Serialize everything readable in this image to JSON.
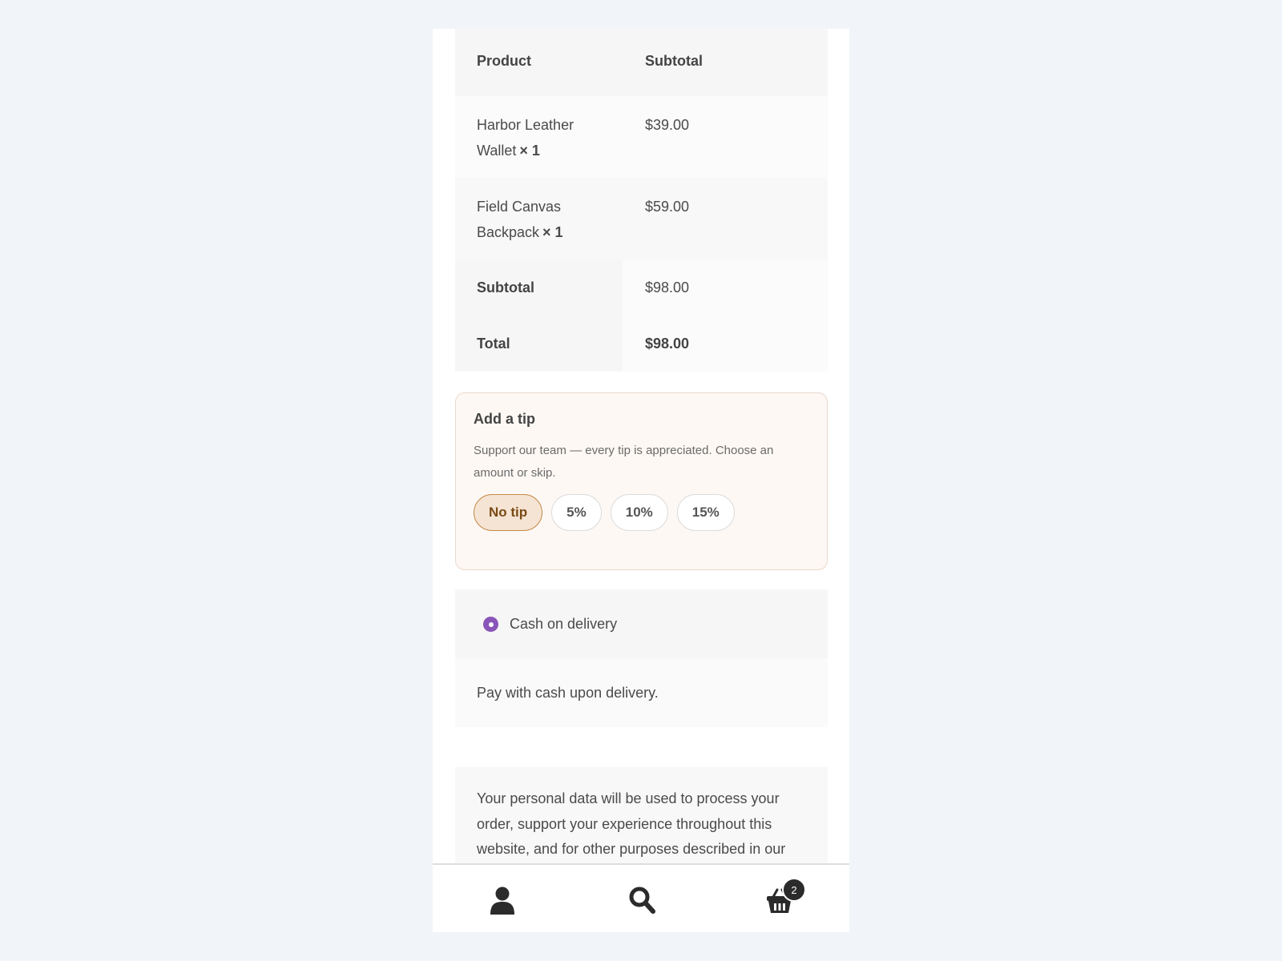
{
  "order": {
    "header": {
      "product": "Product",
      "subtotal": "Subtotal"
    },
    "items": [
      {
        "name": "Harbor Leather Wallet",
        "qty": "× 1",
        "price": "$39.00"
      },
      {
        "name": "Field Canvas Backpack",
        "qty": "× 1",
        "price": "$59.00"
      }
    ],
    "subtotal_label": "Subtotal",
    "subtotal_value": "$98.00",
    "total_label": "Total",
    "total_value": "$98.00"
  },
  "tip": {
    "title": "Add a tip",
    "description": "Support our team — every tip is appreciated. Choose an amount or skip.",
    "options": [
      "No tip",
      "5%",
      "10%",
      "15%"
    ],
    "selected": "No tip"
  },
  "payment": {
    "method_label": "Cash on delivery",
    "method_description": "Pay with cash upon delivery."
  },
  "privacy": {
    "text": "Your personal data will be used to process your order, support your experience throughout this website, and for other purposes described in our"
  },
  "bottom_nav": {
    "cart_count": "2",
    "icons": [
      "user-icon",
      "search-icon",
      "cart-icon"
    ]
  },
  "colors": {
    "page_background": "#f1f5f9",
    "tip_selected_bg": "#f5e4d3",
    "tip_selected_border": "#c68a4a",
    "radio_accent": "#8a55b8"
  }
}
